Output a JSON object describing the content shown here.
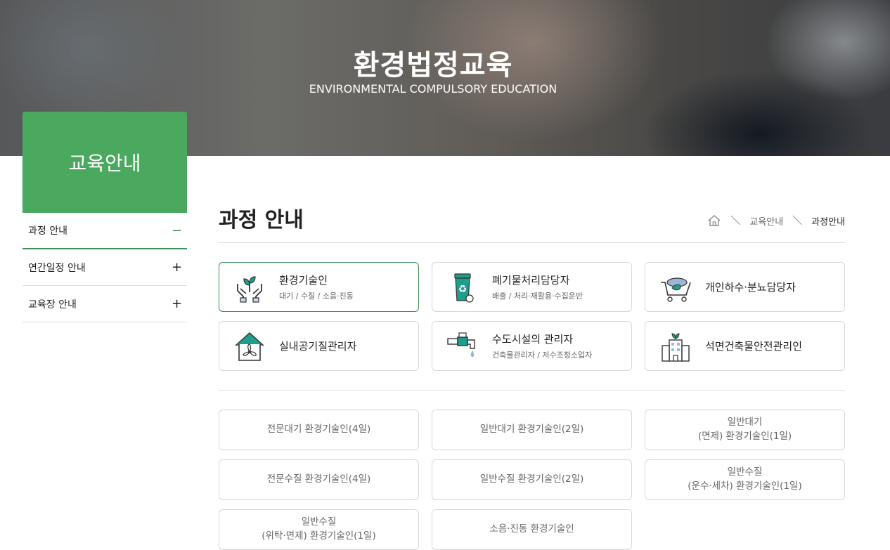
{
  "hero": {
    "title": "환경법정교육",
    "subtitle": "ENVIRONMENTAL COMPULSORY EDUCATION"
  },
  "sidebar": {
    "title": "교육안내",
    "items": [
      {
        "label": "과정 안내",
        "sign": "−"
      },
      {
        "label": "연간일정 안내",
        "sign": "+"
      },
      {
        "label": "교육장 안내",
        "sign": "+"
      }
    ]
  },
  "page": {
    "title": "과정 안내"
  },
  "breadcrumb": {
    "home_icon": "home-icon",
    "section": "교육안내",
    "current": "과정안내"
  },
  "categories": [
    {
      "name": "환경기술인",
      "desc": "대기 / 수질 / 소음·진동",
      "icon": "plant-hands-icon"
    },
    {
      "name": "폐기물처리담당자",
      "desc": "배출 / 처리·재활용·수집운반",
      "icon": "recycle-bin-icon"
    },
    {
      "name": "개인하수·분뇨담당자",
      "desc": "",
      "icon": "cart-icon"
    },
    {
      "name": "실내공기질관리자",
      "desc": "",
      "icon": "house-fan-icon"
    },
    {
      "name": "수도시설의 관리자",
      "desc": "건축물관리자 / 저수조청소업자",
      "icon": "faucet-icon"
    },
    {
      "name": "석면건축물안전관리인",
      "desc": "",
      "icon": "building-icon"
    }
  ],
  "courses": [
    {
      "line1": "전문대기 환경기술인(4일)",
      "line2": ""
    },
    {
      "line1": "일반대기 환경기술인(2일)",
      "line2": ""
    },
    {
      "line1": "일반대기",
      "line2": "(면제) 환경기술인(1일)"
    },
    {
      "line1": "전문수질 환경기술인(4일)",
      "line2": ""
    },
    {
      "line1": "일반수질 환경기술인(2일)",
      "line2": ""
    },
    {
      "line1": "일반수질",
      "line2": "(운수·세차) 환경기술인(1일)"
    },
    {
      "line1": "일반수질",
      "line2": "(위탁·면제) 환경기술인(1일)"
    },
    {
      "line1": "소음·진동 환경기술인",
      "line2": ""
    }
  ],
  "colors": {
    "accent": "#4aa85f",
    "accent_dark": "#3b8f55",
    "icon_teal": "#1f9e8a"
  }
}
